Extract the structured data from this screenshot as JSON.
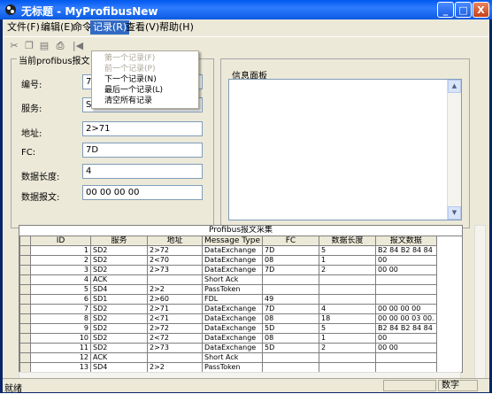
{
  "window": {
    "title": "无标题 - MyProfibusNew",
    "minimize": "_",
    "maximize": "□",
    "close": "X"
  },
  "menubar": {
    "items": [
      "文件(F)",
      "编辑(E)",
      "命令",
      "记录(R)",
      "查看(V)",
      "帮助(H)"
    ]
  },
  "record_menu": {
    "items": [
      {
        "label": "第一个记录(F)",
        "enabled": false
      },
      {
        "label": "前一个记录(P)",
        "enabled": false
      },
      {
        "label": "下一个记录(N)",
        "enabled": true
      },
      {
        "label": "最后一个记录(L)",
        "enabled": true
      },
      {
        "label": "清空所有记录",
        "enabled": true
      }
    ]
  },
  "current_frame": {
    "group_label": "当前profibus报文",
    "fields": [
      {
        "label": "编号:",
        "value": "7"
      },
      {
        "label": "服务:",
        "value": "SD2"
      },
      {
        "label": "地址:",
        "value": "2>71"
      },
      {
        "label": "FC:",
        "value": "7D"
      },
      {
        "label": "数据长度:",
        "value": "4"
      },
      {
        "label": "数据报文:",
        "value": "00 00 00 00"
      }
    ]
  },
  "info_panel": {
    "group_label": "信息面板"
  },
  "grid": {
    "title": "Profibus报文采集",
    "columns": [
      "ID",
      "服务",
      "地址",
      "Message Type",
      "FC",
      "数据长度",
      "报文数据"
    ],
    "rows": [
      [
        "1",
        "SD2",
        "2>72",
        "DataExchange",
        "7D",
        "5",
        "B2 84 B2 84 84"
      ],
      [
        "2",
        "SD2",
        "2<70",
        "DataExchange",
        "08",
        "1",
        "00"
      ],
      [
        "3",
        "SD2",
        "2>73",
        "DataExchange",
        "7D",
        "2",
        "00 00"
      ],
      [
        "4",
        "ACK",
        "",
        "Short Ack",
        "",
        "",
        ""
      ],
      [
        "5",
        "SD4",
        "2>2",
        "PassToken",
        "",
        "",
        ""
      ],
      [
        "6",
        "SD1",
        "2>60",
        "FDL",
        "49",
        "",
        ""
      ],
      [
        "7",
        "SD2",
        "2>71",
        "DataExchange",
        "7D",
        "4",
        "00 00 00 00"
      ],
      [
        "8",
        "SD2",
        "2<71",
        "DataExchange",
        "08",
        "18",
        "00 00 00 03 00."
      ],
      [
        "9",
        "SD2",
        "2>72",
        "DataExchange",
        "5D",
        "5",
        "B2 84 B2 84 84"
      ],
      [
        "10",
        "SD2",
        "2<72",
        "DataExchange",
        "08",
        "1",
        "00"
      ],
      [
        "11",
        "SD2",
        "2>73",
        "DataExchange",
        "5D",
        "2",
        "00 00"
      ],
      [
        "12",
        "ACK",
        "",
        "Short Ack",
        "",
        "",
        ""
      ],
      [
        "13",
        "SD4",
        "2>2",
        "PassToken",
        "",
        "",
        ""
      ]
    ]
  },
  "statusbar": {
    "text": "就绪",
    "pane": "数字"
  }
}
